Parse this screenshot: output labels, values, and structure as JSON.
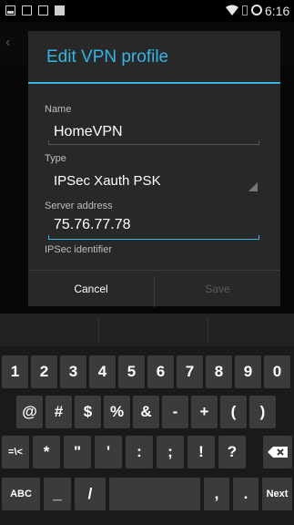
{
  "status_bar": {
    "time": "6:16",
    "icons": [
      "notification-icon",
      "image-icon",
      "bag-icon",
      "clipboard-icon",
      "wifi-icon",
      "sim-icon",
      "sync-icon"
    ]
  },
  "dialog": {
    "title": "Edit VPN profile",
    "fields": {
      "name_label": "Name",
      "name_value": "HomeVPN",
      "type_label": "Type",
      "type_value": "IPSec Xauth PSK",
      "server_label": "Server address",
      "server_value": "75.76.77.78",
      "ipsec_label": "IPSec identifier"
    },
    "buttons": {
      "cancel": "Cancel",
      "save": "Save"
    }
  },
  "colors": {
    "accent": "#33b5e5",
    "dialog_bg": "#282828",
    "key_bg": "#3b3b3b",
    "keyboard_bg": "#1a1a1a"
  },
  "keyboard": {
    "row1": [
      "1",
      "2",
      "3",
      "4",
      "5",
      "6",
      "7",
      "8",
      "9",
      "0"
    ],
    "row2": [
      "@",
      "#",
      "$",
      "%",
      "&",
      "-",
      "+",
      "(",
      ")"
    ],
    "row3": [
      "=\\<",
      "*",
      "\"",
      "'",
      ":",
      ";",
      "!",
      "?"
    ],
    "row4": [
      "ABC",
      "_",
      "/",
      ",",
      ".",
      "Next"
    ]
  }
}
